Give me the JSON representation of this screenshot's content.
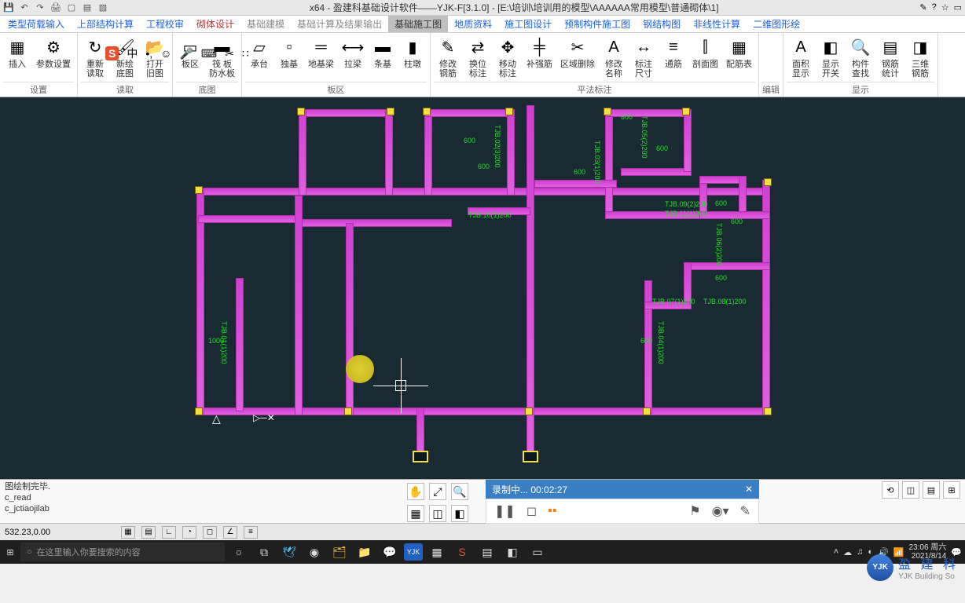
{
  "title": "x64 - 盈建科基础设计软件——YJK-F[3.1.0] - [E:\\培训\\培训用的模型\\AAAAAA常用模型\\普通砌体\\1]",
  "menu": [
    "类型荷载输入",
    "上部结构计算",
    "工程校审",
    "砌体设计",
    "基础建模",
    "基础计算及结果输出",
    "基础施工图",
    "地质资料",
    "施工图设计",
    "预制构件施工图",
    "钢结构图",
    "非线性计算",
    "二维图形绘"
  ],
  "menu_active_index": 6,
  "ribbon_groups": [
    {
      "label": "设置",
      "buttons": [
        {
          "label": "插入",
          "icon": "grid"
        },
        {
          "label": "参数设置",
          "icon": "gear"
        }
      ]
    },
    {
      "label": "读取",
      "buttons": [
        {
          "label": "重新\n读取",
          "icon": "refresh"
        },
        {
          "label": "新绘\n底图",
          "icon": "brush"
        },
        {
          "label": "打开\n旧图",
          "icon": "open"
        }
      ]
    },
    {
      "label": "底图",
      "buttons": [
        {
          "label": "板区",
          "icon": "rect"
        },
        {
          "label": "筏 板\n防水板",
          "icon": "slab"
        }
      ]
    },
    {
      "label": "板区",
      "buttons": [
        {
          "label": "承台",
          "icon": "cap"
        },
        {
          "label": "独基",
          "icon": "pad"
        },
        {
          "label": "地基梁",
          "icon": "beam"
        },
        {
          "label": "拉梁",
          "icon": "tie"
        },
        {
          "label": "条基",
          "icon": "strip"
        },
        {
          "label": "柱墩",
          "icon": "col"
        }
      ]
    },
    {
      "label": "平法标注",
      "buttons": [
        {
          "label": "修改\n钢筋",
          "icon": "edit"
        },
        {
          "label": "换位\n标注",
          "icon": "swap"
        },
        {
          "label": "移动\n标注",
          "icon": "move"
        },
        {
          "label": "补强筋",
          "icon": "reinf"
        },
        {
          "label": "区域删除",
          "icon": "del"
        },
        {
          "label": "修改\n名称",
          "icon": "text"
        },
        {
          "label": "标注\n尺寸",
          "icon": "dim"
        },
        {
          "label": "通筋",
          "icon": "bar"
        },
        {
          "label": "剖面图",
          "icon": "sect"
        },
        {
          "label": "配筋表",
          "icon": "table"
        }
      ]
    },
    {
      "label": "编辑",
      "buttons": []
    },
    {
      "label": "显示",
      "buttons": [
        {
          "label": "面积\n显示",
          "icon": "area"
        },
        {
          "label": "显示\n开关",
          "icon": "switch"
        },
        {
          "label": "构件\n查找",
          "icon": "find"
        },
        {
          "label": "钢筋\n统计",
          "icon": "stat"
        },
        {
          "label": "三维\n钢筋",
          "icon": "3d"
        }
      ]
    }
  ],
  "canvas": {
    "dims": [
      "TJB.01(1)200",
      "TJB.02(3)200",
      "TJB.03(1)200",
      "TJB.04(1)200",
      "TJB.05(2)200",
      "TJB.06(2)200",
      "TJB.07(1)200",
      "TJB.08(1)200",
      "TJB.09(2)200",
      "TJB.10(1)200",
      "TJB.11(1)200"
    ],
    "dim_vals": [
      "600",
      "600",
      "600",
      "600",
      "600",
      "600",
      "600",
      "600",
      "600",
      "1000"
    ]
  },
  "cmd_log": [
    "图绘制完毕.",
    "c_read",
    "c_jctiaojilab"
  ],
  "recorder": {
    "status": "录制中...",
    "time": "00:02:27"
  },
  "status": {
    "coords": "532.23,0.00"
  },
  "ime": {
    "label": "中"
  },
  "logo": {
    "short": "YJK",
    "text": "盈 建 科",
    "sub": "YJK Building So"
  },
  "taskbar": {
    "search_placeholder": "在这里输入你要搜索的内容",
    "time": "23:06 周六",
    "date": "2021/8/14"
  }
}
